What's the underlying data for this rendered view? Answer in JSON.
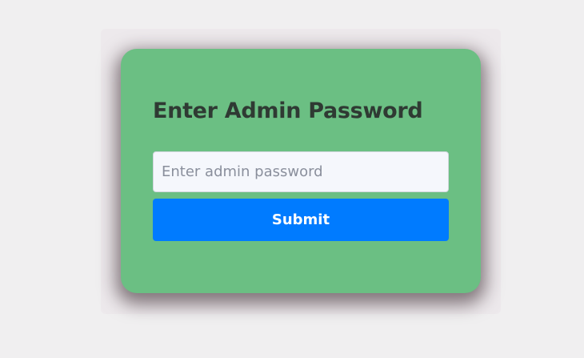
{
  "colors": {
    "page_background": "#f0eff0",
    "card_background": "#6bbf83",
    "title_text": "#2f3a33",
    "input_background": "#f5f7fc",
    "button_background": "#007bff",
    "button_text": "#ffffff"
  },
  "login": {
    "title": "Enter Admin Password",
    "password_input": {
      "value": "",
      "placeholder": "Enter admin password"
    },
    "submit_label": "Submit"
  }
}
